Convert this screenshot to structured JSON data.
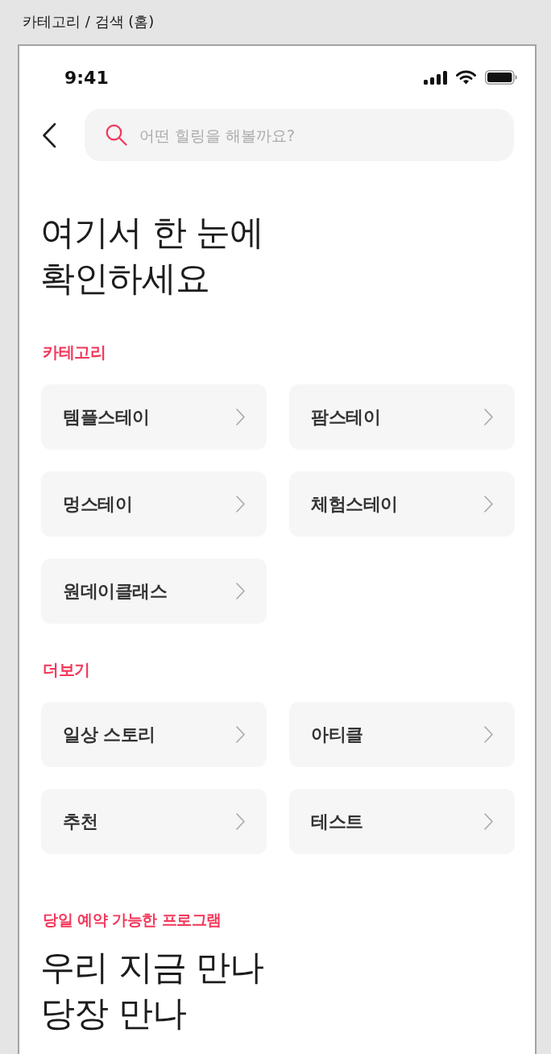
{
  "page_title": "카테고리 / 검색 (홈)",
  "status_bar": {
    "time": "9:41"
  },
  "search": {
    "placeholder": "어떤 힐링을 해볼까요?"
  },
  "headline": {
    "lines": [
      "여기서 한 눈에",
      "확인하세요"
    ]
  },
  "sections": [
    {
      "label": "카테고리",
      "items": [
        {
          "label": "템플스테이"
        },
        {
          "label": "팜스테이"
        },
        {
          "label": "멍스테이"
        },
        {
          "label": "체험스테이"
        },
        {
          "label": "원데이클래스"
        }
      ]
    },
    {
      "label": "더보기",
      "items": [
        {
          "label": "일상 스토리"
        },
        {
          "label": "아티클"
        },
        {
          "label": "추천"
        },
        {
          "label": "테스트"
        }
      ]
    }
  ],
  "promo": {
    "label": "당일 예약 가능한 프로그램",
    "lines": [
      "우리 지금 만나",
      "당장 만나"
    ]
  }
}
